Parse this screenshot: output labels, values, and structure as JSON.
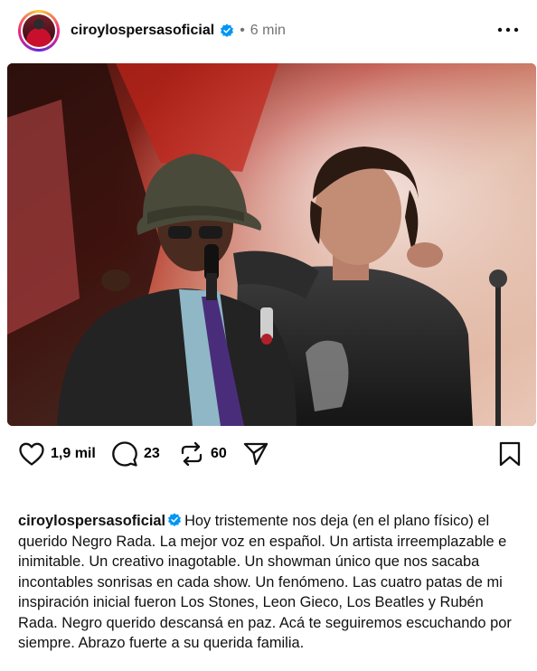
{
  "post": {
    "username": "ciroylospersasoficial",
    "separator": "•",
    "time": "6 min",
    "photo_alt": ""
  },
  "actions": {
    "likes": "1,9 mil",
    "comments": "23",
    "reposts": "60"
  },
  "caption": {
    "username": "ciroylospersasoficial",
    "text": "Hoy tristemente nos deja (en el plano físico) el querido Negro Rada. La mejor voz en español. Un artista irreemplazable e inimitable. Un creativo inagotable. Un showman único que nos sacaba incontables sonrisas en cada show. Un fenómeno. Las cuatro patas de mi inspiración inicial fueron Los Stones, Leon Gieco, Los Beatles y Rubén Rada. Negro querido descansá en paz. Acá te seguiremos escuchando por siempre. Abrazo fuerte a su querida familia."
  },
  "colors": {
    "verified": "#0095f6",
    "muted": "#737373",
    "text": "#000000"
  },
  "icons": {
    "like": "heart-icon",
    "comment": "comment-icon",
    "repost": "repost-icon",
    "share": "paper-plane-icon",
    "save": "bookmark-icon",
    "more": "more-dots-icon",
    "verified": "verified-badge-icon"
  }
}
